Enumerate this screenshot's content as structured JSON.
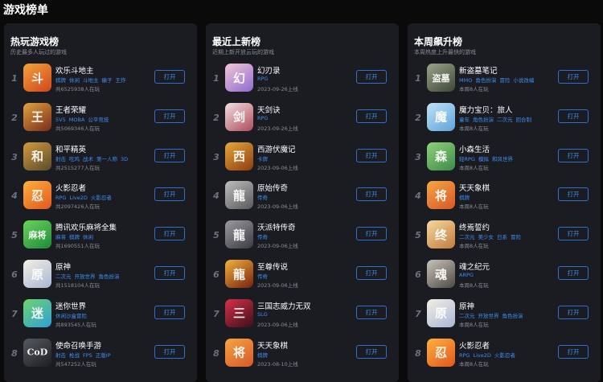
{
  "page": {
    "title": "游戏榜单"
  },
  "colors": {
    "background": "#0a0a0b",
    "panel": "#1b1c21",
    "accent": "#3d8ef0",
    "muted": "#8a8d96"
  },
  "panels": [
    {
      "title": "热玩游戏榜",
      "subtitle": "历史最多人玩过的游戏",
      "items": [
        {
          "rank": "1",
          "name": "欢乐斗地主",
          "tags": [
            "棋牌",
            "休闲",
            "斗地主",
            "癞子",
            "王炸"
          ],
          "meta": "共6525938人在玩",
          "button": "打开",
          "icon_glyph": "斗",
          "icon_colors": [
            "#f3a43b",
            "#d0451b"
          ]
        },
        {
          "rank": "2",
          "name": "王者荣耀",
          "tags": [
            "5V5",
            "MOBA",
            "公平竞技"
          ],
          "meta": "共5069346人在玩",
          "button": "打开",
          "icon_glyph": "王",
          "icon_colors": [
            "#e0a340",
            "#7a2a18"
          ]
        },
        {
          "rank": "3",
          "name": "和平精英",
          "tags": [
            "射击",
            "吃鸡",
            "战术",
            "第一人称",
            "3D"
          ],
          "meta": "共2515277人在玩",
          "button": "打开",
          "icon_glyph": "和",
          "icon_colors": [
            "#d49a3a",
            "#5b4a2d"
          ]
        },
        {
          "rank": "4",
          "name": "火影忍者",
          "tags": [
            "RPG",
            "Live2D",
            "火影忍者"
          ],
          "meta": "共2097426人在玩",
          "button": "打开",
          "icon_glyph": "忍",
          "icon_colors": [
            "#ffb23c",
            "#e0561f"
          ]
        },
        {
          "rank": "5",
          "name": "腾讯欢乐麻将全集",
          "tags": [
            "麻将",
            "棋牌",
            "休闲"
          ],
          "meta": "共1690551人在玩",
          "button": "打开",
          "icon_glyph": "麻将",
          "icon_colors": [
            "#6bd35a",
            "#1f8a3a"
          ]
        },
        {
          "rank": "6",
          "name": "原神",
          "tags": [
            "二次元",
            "开放世界",
            "角色扮演"
          ],
          "meta": "共1518104人在玩",
          "button": "打开",
          "icon_glyph": "原",
          "icon_colors": [
            "#f4efe6",
            "#a8b6d4"
          ]
        },
        {
          "rank": "7",
          "name": "迷你世界",
          "tags": [
            "休闲沙盒冒险"
          ],
          "meta": "共893545人在玩",
          "button": "打开",
          "icon_glyph": "迷",
          "icon_colors": [
            "#6fd36b",
            "#2e9fd9"
          ]
        },
        {
          "rank": "8",
          "name": "使命召唤手游",
          "tags": [
            "射击",
            "枪战",
            "FPS",
            "正版IP"
          ],
          "meta": "共547252人在玩",
          "button": "打开",
          "icon_glyph": "CoD",
          "icon_colors": [
            "#555a60",
            "#1c1e20"
          ]
        }
      ]
    },
    {
      "title": "最近上新榜",
      "subtitle": "近期上新开放云玩的游戏",
      "items": [
        {
          "rank": "1",
          "name": "幻刃录",
          "tags": [
            "RPG"
          ],
          "meta": "2023-09-26上线",
          "button": "打开",
          "icon_glyph": "幻",
          "icon_colors": [
            "#f5c6d6",
            "#8d6bd1"
          ]
        },
        {
          "rank": "2",
          "name": "天剑诀",
          "tags": [
            "RPG"
          ],
          "meta": "2023-09-26上线",
          "button": "打开",
          "icon_glyph": "剑",
          "icon_colors": [
            "#f2e1e4",
            "#b0495a"
          ]
        },
        {
          "rank": "3",
          "name": "西游伏魔记",
          "tags": [
            "卡牌"
          ],
          "meta": "2023-09-06上线",
          "button": "打开",
          "icon_glyph": "西",
          "icon_colors": [
            "#e6a83a",
            "#8a3c12"
          ]
        },
        {
          "rank": "4",
          "name": "原始传奇",
          "tags": [
            "传奇"
          ],
          "meta": "2023-09-06上线",
          "button": "打开",
          "icon_glyph": "龍",
          "icon_colors": [
            "#bdbdbd",
            "#5a5a5a"
          ]
        },
        {
          "rank": "5",
          "name": "沃派特传奇",
          "tags": [
            "传奇"
          ],
          "meta": "2023-09-06上线",
          "button": "打开",
          "icon_glyph": "龍",
          "icon_colors": [
            "#9b9ba0",
            "#3a3a40"
          ]
        },
        {
          "rank": "6",
          "name": "至尊传说",
          "tags": [
            "传奇"
          ],
          "meta": "2023-09-06上线",
          "button": "打开",
          "icon_glyph": "龍",
          "icon_colors": [
            "#f0b43a",
            "#7a1f10"
          ]
        },
        {
          "rank": "7",
          "name": "三国志威力无双",
          "tags": [
            "SLG"
          ],
          "meta": "2023-09-06上线",
          "button": "打开",
          "icon_glyph": "三",
          "icon_colors": [
            "#d9304a",
            "#3a1018"
          ]
        },
        {
          "rank": "8",
          "name": "天天象棋",
          "tags": [
            "棋牌"
          ],
          "meta": "2023-08-10上线",
          "button": "打开",
          "icon_glyph": "将",
          "icon_colors": [
            "#f5a640",
            "#d8572a"
          ]
        }
      ]
    },
    {
      "title": "本周飙升榜",
      "subtitle": "本周热度上升最快的游戏",
      "items": [
        {
          "rank": "1",
          "name": "新盗墓笔记",
          "tags": [
            "MMO",
            "角色扮演",
            "冒险",
            "小说改编"
          ],
          "meta": "本周8人在玩",
          "button": "打开",
          "icon_glyph": "盗墓",
          "icon_colors": [
            "#9aa58a",
            "#3d4636"
          ]
        },
        {
          "rank": "2",
          "name": "魔力宝贝：旅人",
          "tags": [
            "童年",
            "角色扮演",
            "二次元",
            "回合制"
          ],
          "meta": "本周8人在玩",
          "button": "打开",
          "icon_glyph": "魔",
          "icon_colors": [
            "#bfe3f7",
            "#5fa3d8"
          ]
        },
        {
          "rank": "3",
          "name": "小森生活",
          "tags": [
            "轻RPG",
            "模拟",
            "和风世界"
          ],
          "meta": "本周8人在玩",
          "button": "打开",
          "icon_glyph": "森",
          "icon_colors": [
            "#8fd07a",
            "#3e8a4a"
          ]
        },
        {
          "rank": "4",
          "name": "天天象棋",
          "tags": [
            "棋牌"
          ],
          "meta": "本周8人在玩",
          "button": "打开",
          "icon_glyph": "将",
          "icon_colors": [
            "#f5a640",
            "#d8572a"
          ]
        },
        {
          "rank": "5",
          "name": "终焉誓约",
          "tags": [
            "二次元",
            "美少女",
            "日系",
            "冒险"
          ],
          "meta": "本周8人在玩",
          "button": "打开",
          "icon_glyph": "终",
          "icon_colors": [
            "#f6d9a0",
            "#c27a3c"
          ]
        },
        {
          "rank": "6",
          "name": "魂之纪元",
          "tags": [
            "ARPG"
          ],
          "meta": "本周8人在玩",
          "button": "打开",
          "icon_glyph": "魂",
          "icon_colors": [
            "#c9c4b8",
            "#4e4a44"
          ]
        },
        {
          "rank": "7",
          "name": "原神",
          "tags": [
            "二次元",
            "开放世界",
            "角色扮演"
          ],
          "meta": "本周8人在玩",
          "button": "打开",
          "icon_glyph": "原",
          "icon_colors": [
            "#f4efe6",
            "#a8b6d4"
          ]
        },
        {
          "rank": "8",
          "name": "火影忍者",
          "tags": [
            "RPG",
            "Live2D",
            "火影忍者"
          ],
          "meta": "本周8人在玩",
          "button": "打开",
          "icon_glyph": "忍",
          "icon_colors": [
            "#ffb23c",
            "#e0561f"
          ]
        }
      ]
    }
  ]
}
